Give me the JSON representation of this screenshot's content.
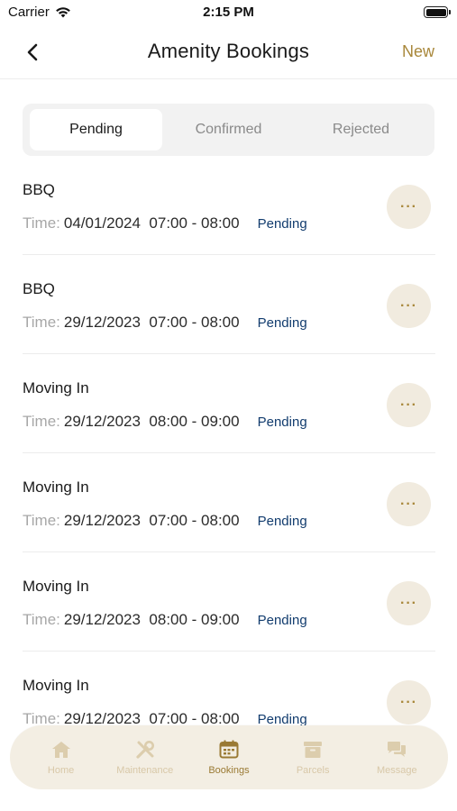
{
  "status_bar": {
    "carrier": "Carrier",
    "time": "2:15 PM"
  },
  "header": {
    "title": "Amenity Bookings",
    "new_label": "New"
  },
  "tabs": [
    {
      "label": "Pending",
      "active": true
    },
    {
      "label": "Confirmed",
      "active": false
    },
    {
      "label": "Rejected",
      "active": false
    }
  ],
  "bookings": [
    {
      "title": "BBQ",
      "time_label": "Time:",
      "time_value": "04/01/2024  07:00 - 08:00",
      "status": "Pending"
    },
    {
      "title": "BBQ",
      "time_label": "Time:",
      "time_value": "29/12/2023  07:00 - 08:00",
      "status": "Pending"
    },
    {
      "title": "Moving In",
      "time_label": "Time:",
      "time_value": "29/12/2023  08:00 - 09:00",
      "status": "Pending"
    },
    {
      "title": "Moving In",
      "time_label": "Time:",
      "time_value": "29/12/2023  07:00 - 08:00",
      "status": "Pending"
    },
    {
      "title": "Moving In",
      "time_label": "Time:",
      "time_value": "29/12/2023  08:00 - 09:00",
      "status": "Pending"
    },
    {
      "title": "Moving In",
      "time_label": "Time:",
      "time_value": "29/12/2023  07:00 - 08:00",
      "status": "Pending"
    }
  ],
  "more_label": "···",
  "bottom_nav": [
    {
      "label": "Home",
      "icon": "home-icon",
      "active": false
    },
    {
      "label": "Maintenance",
      "icon": "tools-icon",
      "active": false
    },
    {
      "label": "Bookings",
      "icon": "calendar-icon",
      "active": true
    },
    {
      "label": "Parcels",
      "icon": "parcel-icon",
      "active": false
    },
    {
      "label": "Message",
      "icon": "chat-icon",
      "active": false
    }
  ],
  "colors": {
    "accent": "#a8873a",
    "status": "#123c6e",
    "tab_bar_bg": "#f3eee3",
    "more_bg": "#f1ebdf"
  }
}
